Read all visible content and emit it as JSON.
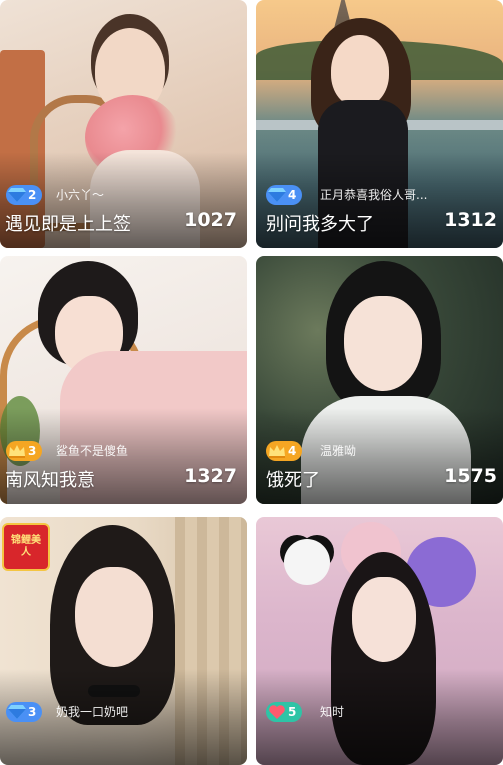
{
  "cards": [
    {
      "title": "遇见即是上上签",
      "username": "小六丫～",
      "level": "2",
      "level_icon": "diamond-icon",
      "level_color": "#4a90f5",
      "viewers": "1027"
    },
    {
      "title": "别问我多大了",
      "username": "正月恭喜我俗人哥...",
      "level": "4",
      "level_icon": "diamond-icon",
      "level_color": "#4a90f5",
      "viewers": "1312"
    },
    {
      "title": "南风知我意",
      "username": "鲨鱼不是傻鱼",
      "level": "3",
      "level_icon": "crown-icon",
      "level_color": "#f5a623",
      "viewers": "1327"
    },
    {
      "title": "饿死了",
      "username": "温雅呦",
      "level": "4",
      "level_icon": "crown-icon",
      "level_color": "#f5a623",
      "viewers": "1575"
    },
    {
      "title": "",
      "username": "奶我一口奶吧",
      "level": "3",
      "level_icon": "diamond-icon",
      "level_color": "#4a90f5",
      "viewers": "",
      "sticker_text": "锦鲤美人"
    },
    {
      "title": "",
      "username": "知时",
      "level": "5",
      "level_icon": "heart-icon",
      "level_color": "#2ec4a6",
      "viewers": ""
    }
  ]
}
